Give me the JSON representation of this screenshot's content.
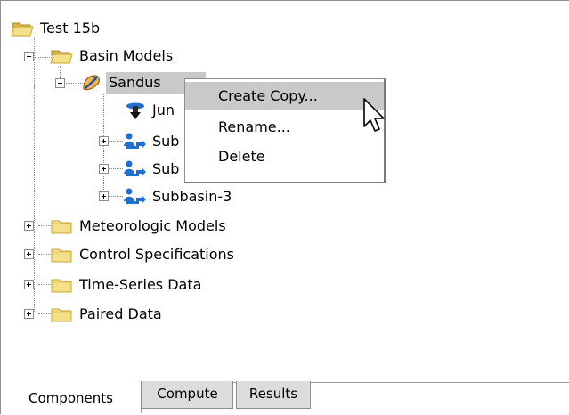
{
  "tree": {
    "root": {
      "label": "Test 15b",
      "icon": "folder-open-icon"
    },
    "basin_models": {
      "label": "Basin Models",
      "icon": "folder-open-icon"
    },
    "basin": {
      "label": "Sandus",
      "icon": "basin-model-icon"
    },
    "children": [
      {
        "label": "Jun",
        "icon": "junction-icon"
      },
      {
        "label": "Sub",
        "icon": "subbasin-icon"
      },
      {
        "label": "Sub",
        "icon": "subbasin-icon"
      },
      {
        "label": "Subbasin-3",
        "icon": "subbasin-icon"
      }
    ],
    "top_level": [
      {
        "label": "Meteorologic Models",
        "icon": "folder-icon"
      },
      {
        "label": "Control Specifications",
        "icon": "folder-icon"
      },
      {
        "label": "Time-Series Data",
        "icon": "folder-icon"
      },
      {
        "label": "Paired Data",
        "icon": "folder-icon"
      }
    ]
  },
  "context_menu": {
    "items": [
      {
        "label": "Create Copy...",
        "highlighted": true
      },
      {
        "label": "Rename...",
        "highlighted": false
      },
      {
        "label": "Delete",
        "highlighted": false
      }
    ]
  },
  "tabs": [
    {
      "label": "Components",
      "active": true
    },
    {
      "label": "Compute",
      "active": false
    },
    {
      "label": "Results",
      "active": false
    }
  ],
  "colors": {
    "selection": "#c9c9cc",
    "folder": "#f5e08a",
    "folder_edge": "#c8a436",
    "subbasin_blue": "#1f6fd1",
    "basin_orange": "#e8902a"
  }
}
